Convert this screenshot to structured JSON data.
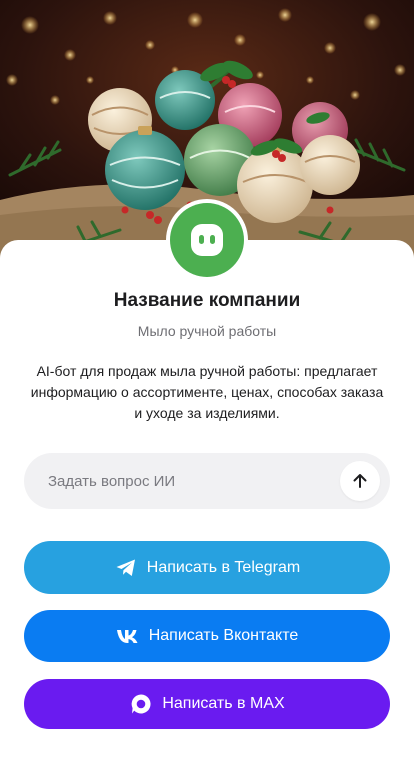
{
  "colors": {
    "brand": "#4caf50",
    "telegram": "#27a1e0",
    "vk": "#0a7cf2",
    "max": "#6a1bf0"
  },
  "hero": {
    "image": "christmas-soap-ornaments-illustration"
  },
  "company": {
    "avatar_icon": "chat-bubble-icon",
    "name": "Название компании",
    "tagline": "Мыло ручной работы",
    "description": "AI-бот для продаж мыла ручной работы: предлагает информацию о ассортименте, ценах, способах заказа и уходе за изделиями."
  },
  "ask": {
    "placeholder": "Задать вопрос ИИ",
    "value": "",
    "send_icon": "arrow-up-icon"
  },
  "buttons": {
    "telegram": {
      "label": "Написать в Telegram",
      "icon": "telegram-icon"
    },
    "vk": {
      "label": "Написать Вконтакте",
      "icon": "vk-icon"
    },
    "max": {
      "label": "Написать в MAX",
      "icon": "max-icon"
    }
  }
}
